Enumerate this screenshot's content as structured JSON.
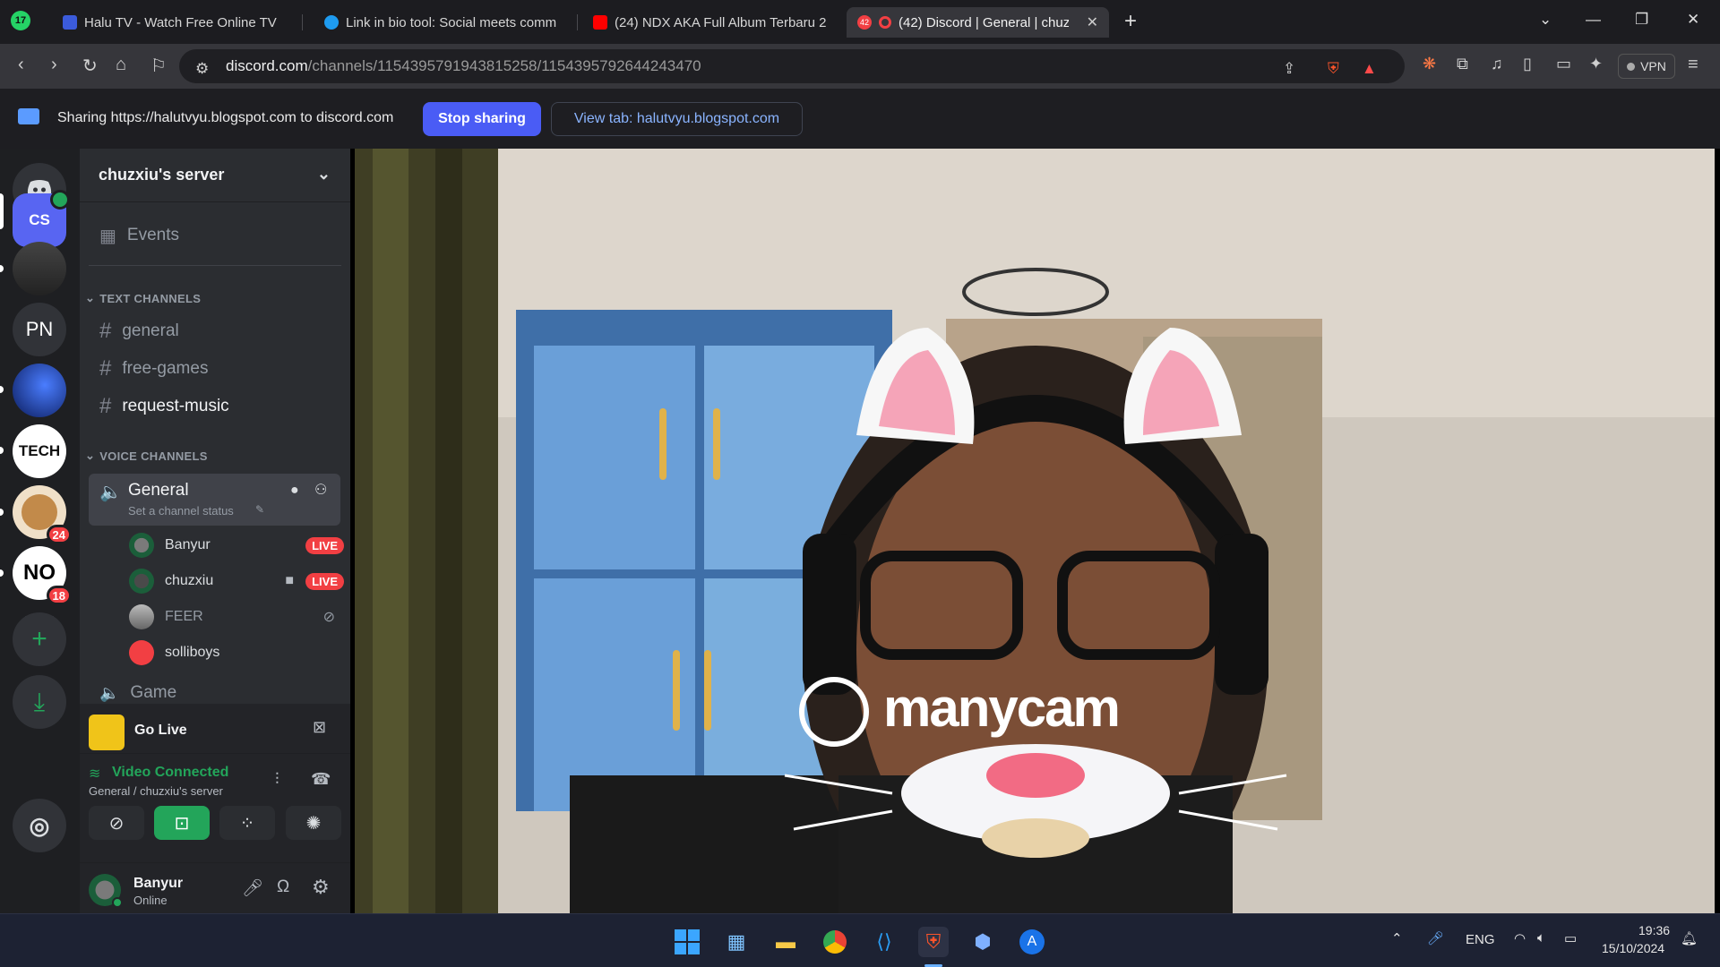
{
  "browser": {
    "tab_badge": "17",
    "tabs": [
      {
        "title": "Halu TV - Watch Free Online TV"
      },
      {
        "title": "Link in bio tool: Social meets comm"
      },
      {
        "title": "(24) NDX AKA Full Album Terbaru 2"
      },
      {
        "title": "(42) Discord | General | chuz"
      }
    ],
    "active_tab_badge": "42",
    "url_host": "discord.com",
    "url_path": "/channels/1154395791943815258/1154395792644243470",
    "vpn_label": "VPN"
  },
  "share_bar": {
    "text": "Sharing https://halutvyu.blogspot.com to discord.com",
    "stop_label": "Stop sharing",
    "view_label": "View tab: halutvyu.blogspot.com"
  },
  "rail": {
    "servers": [
      {
        "label": "CS",
        "color": "#5865f2"
      },
      {
        "label": "PN",
        "color": "#313338"
      },
      {
        "label": "TECH",
        "color": "#ffffff"
      },
      {
        "label": "NO",
        "color": "#ffffff"
      }
    ],
    "badges": [
      "24",
      "18"
    ]
  },
  "server": {
    "name": "chuzxiu's server",
    "events_label": "Events",
    "text_category": "TEXT CHANNELS",
    "text_channels": [
      "general",
      "free-games",
      "request-music"
    ],
    "voice_category": "VOICE CHANNELS",
    "voice_channel": "General",
    "voice_status": "Set a channel status",
    "voice_users": [
      {
        "name": "Banyur",
        "live": "LIVE"
      },
      {
        "name": "chuzxiu",
        "live": "LIVE"
      },
      {
        "name": "FEER"
      },
      {
        "name": "solliboys"
      }
    ],
    "next_channel": "Game"
  },
  "panels": {
    "golive_label": "Go Live",
    "vc_title": "Video Connected",
    "vc_sub": "General / chuzxiu's server",
    "user_name": "Banyur",
    "user_status": "Online"
  },
  "video": {
    "watermark": "manycam"
  },
  "taskbar": {
    "lang": "ENG",
    "time": "19:36",
    "date": "15/10/2024"
  },
  "colors": {
    "accent": "#5865f2",
    "live": "#f23f43",
    "connected": "#23a55a"
  }
}
